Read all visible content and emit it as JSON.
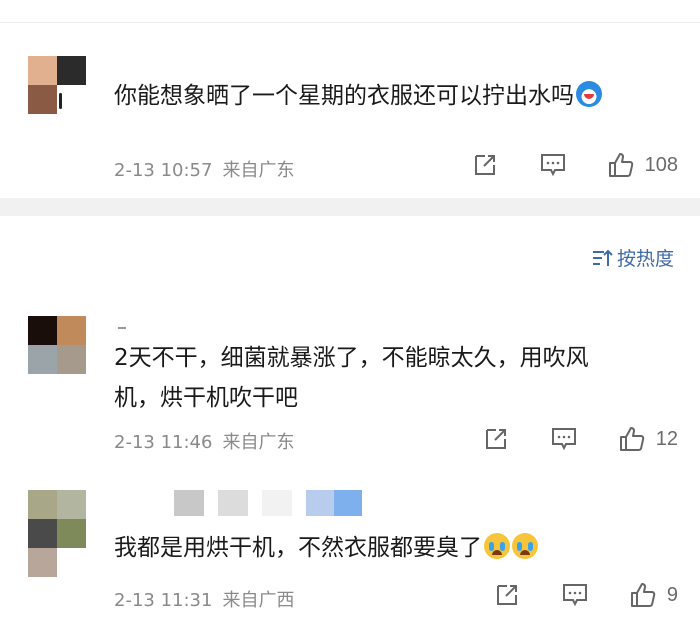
{
  "comments": [
    {
      "text": "你能想象晒了一个星期的衣服还可以拧出水吗",
      "emoji": "doraemon-emoji",
      "time": "2-13 10:57",
      "location": "来自广东",
      "likes": "108",
      "avatar_colors": [
        "#e0b08f",
        "#2b2b2b",
        "#8b5a44",
        "#ffffff"
      ]
    },
    {
      "text_line1": "2天不干，细菌就暴涨了，不能晾太久，用吹风",
      "text_line2": "机，烘干机吹干吧",
      "time": "2-13 11:46",
      "location": "来自广东",
      "likes": "12",
      "avatar_colors": [
        "#1a0e0a",
        "#c08a5a",
        "#9ba4a8",
        "#a59a8c"
      ]
    },
    {
      "text": "我都是用烘干机，不然衣服都要臭了",
      "emoji": "crying-emoji",
      "time": "2-13 11:31",
      "location": "来自广西",
      "likes": "9",
      "avatar_colors": [
        "#a8a888",
        "#b2b5a0",
        "#4a4a4a",
        "#7f8a5a",
        "#b8a69a",
        "#ffffff"
      ],
      "name_block_colors": [
        "#c8c8c8",
        "#dcdcdc",
        "#f2f2f2",
        "#b8cdee",
        "#7fb0ee"
      ]
    }
  ],
  "sort": {
    "label": "按热度"
  },
  "colors": {
    "accent": "#3f6aa8",
    "meta": "#8a8a8a",
    "band": "#f1f1f1"
  }
}
